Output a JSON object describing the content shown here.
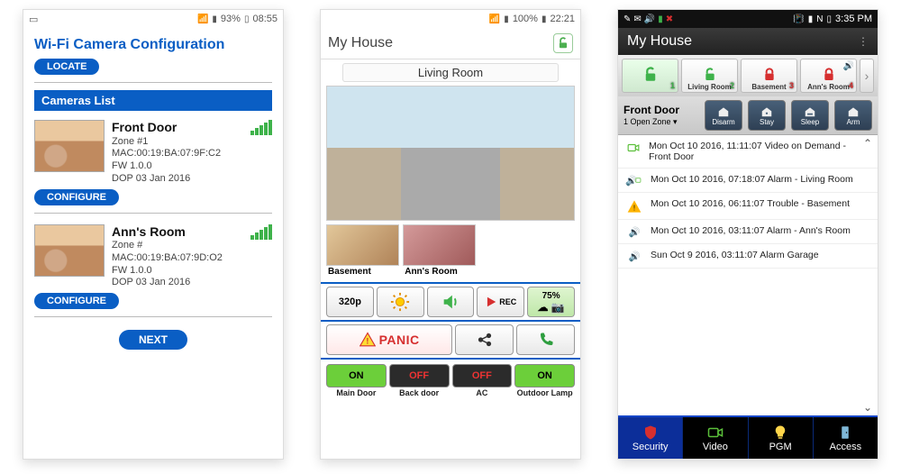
{
  "screen1": {
    "statusbar": {
      "battery": "93%",
      "time": "08:55"
    },
    "title": "Wi-Fi Camera Configuration",
    "locate_btn": "LOCATE",
    "list_header": "Cameras List",
    "configure_btn": "CONFIGURE",
    "next_btn": "NEXT",
    "cameras": [
      {
        "name": "Front Door",
        "zone": "Zone #1",
        "mac": "MAC:00:19:BA:07:9F:C2",
        "fw": "FW 1.0.0",
        "dop": "DOP 03 Jan 2016"
      },
      {
        "name": "Ann's Room",
        "zone": "Zone #",
        "mac": "MAC:00:19:BA:07:9D:O2",
        "fw": "FW 1.0.0",
        "dop": "DOP 03 Jan 2016"
      }
    ]
  },
  "screen2": {
    "statusbar": {
      "battery": "100%",
      "time": "22:21"
    },
    "title": "My House",
    "current_room": "Living Room",
    "thumbs": [
      {
        "label": "Basement"
      },
      {
        "label": "Ann's Room"
      }
    ],
    "controls": {
      "res": "320p",
      "brightness_icon": "sun",
      "sound_icon": "speaker",
      "rec_label": "REC",
      "storage_pct": "75%",
      "panic": "PANIC",
      "share_icon": "share",
      "call_icon": "phone"
    },
    "pgm": [
      {
        "state_label": "ON",
        "state": "on",
        "name": "Main Door"
      },
      {
        "state_label": "OFF",
        "state": "off",
        "name": "Back door"
      },
      {
        "state_label": "OFF",
        "state": "off",
        "name": "AC"
      },
      {
        "state_label": "ON",
        "state": "on",
        "name": "Outdoor Lamp"
      }
    ]
  },
  "screen3": {
    "statusbar": {
      "time": "3:35 PM"
    },
    "title": "My House",
    "areas": [
      {
        "n": "1",
        "label": "",
        "armed": false
      },
      {
        "n": "2",
        "label": "Living Room",
        "armed": false
      },
      {
        "n": "3",
        "label": "Basement",
        "armed": true
      },
      {
        "n": "4",
        "label": "Ann's Room",
        "armed": true,
        "alarm": true
      }
    ],
    "zone": {
      "name": "Front Door",
      "sub": "1 Open Zone ▾"
    },
    "modes": [
      {
        "label": "Disarm"
      },
      {
        "label": "Stay"
      },
      {
        "label": "Sleep"
      },
      {
        "label": "Arm"
      }
    ],
    "events": [
      {
        "icon": "video",
        "text": "Mon Oct 10 2016, 11:11:07 Video on Demand - Front Door"
      },
      {
        "icon": "alarm",
        "text": "Mon Oct 10 2016, 07:18:07 Alarm - Living Room"
      },
      {
        "icon": "trouble",
        "text": "Mon Oct 10 2016, 06:11:07 Trouble - Basement"
      },
      {
        "icon": "alarm",
        "text": "Mon Oct 10 2016, 03:11:07 Alarm - Ann's Room"
      },
      {
        "icon": "alarm",
        "text": "Sun Oct 9 2016, 03:11:07 Alarm Garage"
      }
    ],
    "nav": [
      {
        "label": "Security",
        "icon": "shield",
        "active": true
      },
      {
        "label": "Video",
        "icon": "camera"
      },
      {
        "label": "PGM",
        "icon": "bulb"
      },
      {
        "label": "Access",
        "icon": "door"
      }
    ]
  }
}
